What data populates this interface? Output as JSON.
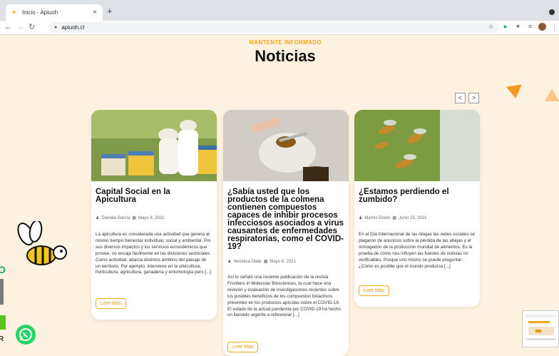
{
  "browser": {
    "tab_title": "Inicio - Apiuoh",
    "tab_close": "×",
    "new_tab": "+",
    "url": "apiuoh.cl"
  },
  "section": {
    "kicker": "MANTENTE INFORMADO",
    "heading": "Noticias",
    "prev": "<",
    "next": ">"
  },
  "cards": [
    {
      "title": "Capital Social en la Apicultura",
      "author": "Daniela García",
      "date": "Mayo 9, 2021",
      "excerpt": "La apicultura es considerada una actividad que genera al mismo tiempo bienestar individual, social y ambiental. Por sus diversos impactos y los servicios ecosistémicos que provee, no encaja fácilmente en las divisiones sectoriales. Como actividad, abarca distintos ámbitos del paisaje de un territorio. Por ejemplo, interviene en la silvicultura, horticultura, agricultura, ganadería y entomología pero [...]",
      "button": "Leer Más"
    },
    {
      "title": "¿Sabía usted que los productos de la colmena contienen compuestos capaces de inhibir procesos infecciosos asociados a virus causantes de enfermedades respiratorias, como el COVID-19?",
      "author": "Verónica Olate",
      "date": "Mayo 8, 2021",
      "excerpt": "Así lo señaló una reciente publicación de la revista Frontiers in Molecular Biosciences, la cual hace una revisión y evaluación de investigaciones recientes sobre los posibles beneficios de los compuestos bioactivos presentes en los productos apícolas sobre el COVID-19.   El estado de la actual pandemia por COVID-19 ha hecho un llamado urgente a reflexionar [...]",
      "button": "Leer Más"
    },
    {
      "title": "¿Estamos perdiendo el zumbido?",
      "author": "Marnix Doorn",
      "date": "Junio 15, 2021",
      "excerpt": "En el Día Internacional de las Abejas las redes sociales se plagaron de anuncios sobre la pérdida de las abejas y el Armagedón de la producción mundial de alimentos. Es la prueba de cómo nos influyen las fuentes de noticias no verificables. Porque uno mismo se puede preguntar: ¿Cómo es posible que el mundo produzca [...]",
      "button": "Leer Más"
    }
  ],
  "edge_letters": [
    "O",
    "R"
  ],
  "colors": {
    "accent": "#f2a918",
    "background": "#fdf1e0",
    "whatsapp": "#25d366"
  }
}
